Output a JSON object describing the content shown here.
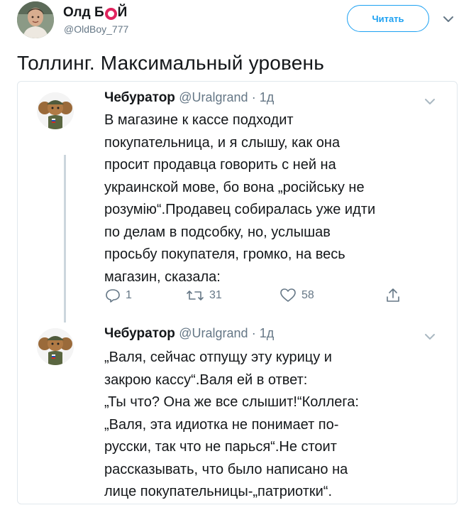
{
  "header": {
    "display_name_part1": "Олд Б",
    "display_name_part2": "Й",
    "handle": "@OldBoy_777",
    "follow_label": "Читать"
  },
  "tweet": {
    "text": "Толлинг. Максимальный уровень"
  },
  "replies": [
    {
      "name": "Чебуратор",
      "handle": "@Uralgrand",
      "time": "· 1д",
      "lines": [
        "В магазине к кассе подходит",
        "покупательница, и я слышу, как она",
        "просит продавца говорить с ней на",
        "украинской мове, бо вона „російську не",
        "розумію“.Продавец собиралась уже идти",
        "по делам в подсобку, но, услышав",
        "просьбу покупателя, громко, на весь",
        "магазин, сказала:"
      ],
      "replies_count": "1",
      "retweets_count": "31",
      "likes_count": "58"
    },
    {
      "name": "Чебуратор",
      "handle": "@Uralgrand",
      "time": "· 1д",
      "lines": [
        "„Валя, сейчас отпущу эту курицу и",
        "закрою кассу“.Валя ей в ответ:",
        "„Ты что? Она же все слышит!“Коллега:",
        "„Валя, эта идиотка не понимает по-",
        "русски, так что не парься“.Не стоит",
        "рассказывать, что было написано на",
        "лице покупательницы-„патриотки“."
      ]
    }
  ],
  "colors": {
    "accent": "#1da1f2",
    "ring": "#e0245e",
    "muted": "#657786",
    "border": "#e1e8ed"
  },
  "icons": [
    "chevron-down-icon",
    "reply-icon",
    "retweet-icon",
    "like-icon",
    "share-icon"
  ]
}
